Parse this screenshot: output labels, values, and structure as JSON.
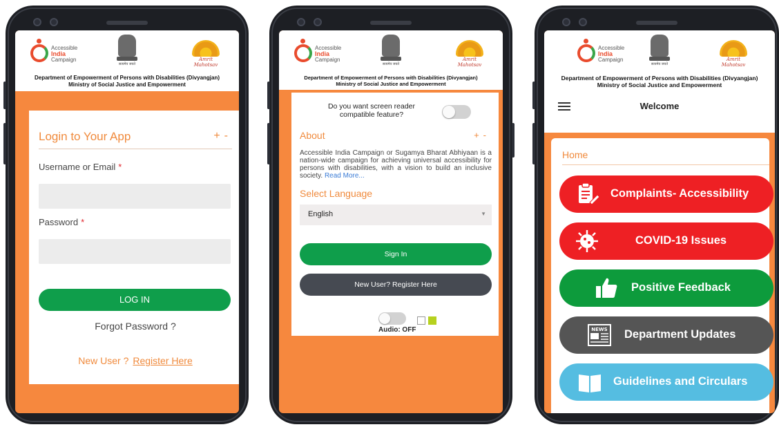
{
  "header": {
    "aic_logo": [
      "Accessible",
      "India",
      "Campaign"
    ],
    "dept_line1": "Department of Empowerment of Persons with Disabilities (Divyangjan)",
    "dept_line2": "Ministry of Social Justice and Empowerment"
  },
  "login": {
    "title": "Login to Your App",
    "plus": "+",
    "minus": "-",
    "username_label": "Username or Email",
    "password_label": "Password",
    "required_mark": "*",
    "login_button": "LOG IN",
    "forgot": "Forgot Password ?",
    "new_user": "New User ?",
    "register": "Register Here"
  },
  "settings": {
    "screen_reader_question": "Do you want screen reader compatible feature?",
    "about_title": "About",
    "about_text": "Accessible India Campaign or Sugamya Bharat Abhiyaan is a nation-wide campaign for achieving universal accessibility for persons with disabilities, with a vision to build an inclusive society.",
    "read_more": "Read More...",
    "language_title": "Select Language",
    "language_selected": "English",
    "sign_in": "Sign In",
    "register_button": "New User? Register Here",
    "audio_label": "Audio: OFF"
  },
  "home": {
    "welcome": "Welcome",
    "home_title": "Home",
    "tiles": [
      {
        "label": "Complaints- Accessibility",
        "color": "#ee2024",
        "icon": "clipboard-pencil-icon"
      },
      {
        "label": "COVID-19 Issues",
        "color": "#ee2024",
        "icon": "virus-icon"
      },
      {
        "label": "Positive Feedback",
        "color": "#0d9b3c",
        "icon": "thumbs-up-icon"
      },
      {
        "label": "Department Updates",
        "color": "#555555",
        "icon": "newspaper-icon"
      },
      {
        "label": "Guidelines and Circulars",
        "color": "#55bde1",
        "icon": "book-icon"
      }
    ]
  },
  "colors": {
    "orange": "#f6883e",
    "green": "#0f9e4b",
    "dark": "#464a52",
    "red": "#ee2024",
    "blue": "#55bde1"
  }
}
